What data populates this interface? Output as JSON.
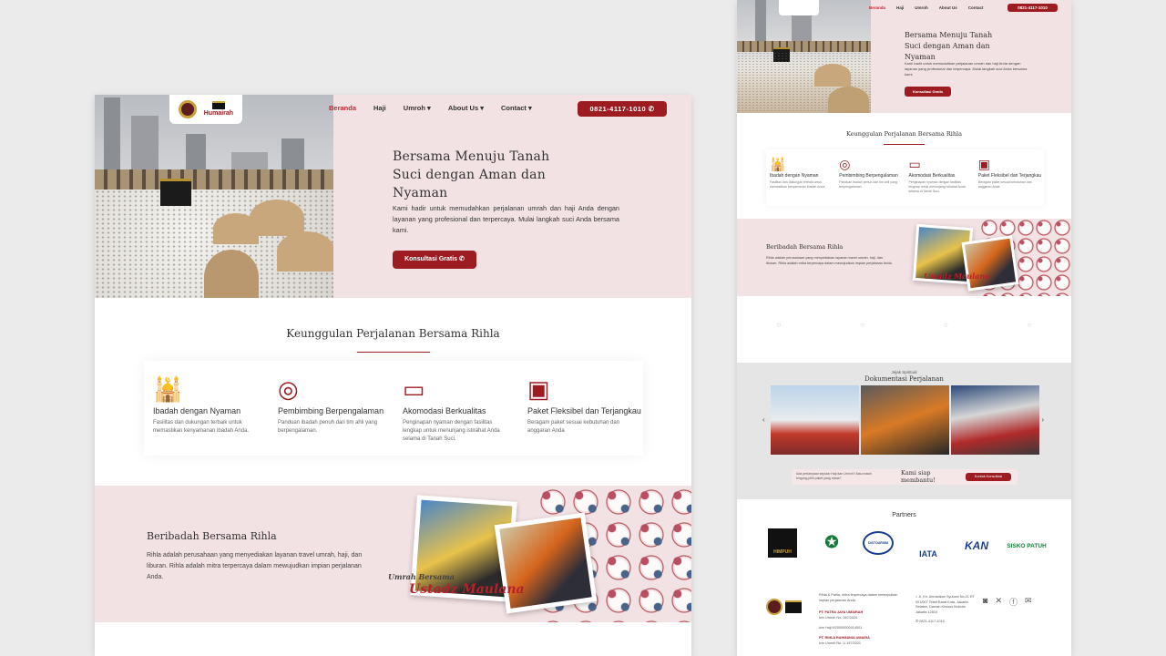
{
  "brand": {
    "name": "Humairah",
    "accent": "#9d1c22",
    "bg_pink": "#f3e2e4"
  },
  "nav": {
    "items": [
      {
        "label": "Beranda",
        "active": true,
        "dropdown": false
      },
      {
        "label": "Haji",
        "active": false,
        "dropdown": false
      },
      {
        "label": "Umroh",
        "active": false,
        "dropdown": true
      },
      {
        "label": "About Us",
        "active": false,
        "dropdown": true
      },
      {
        "label": "Contact",
        "active": false,
        "dropdown": true
      }
    ],
    "phone": "0821-4117-1010",
    "phone_icon": "whatsapp-icon"
  },
  "hero": {
    "title": "Bersama Menuju Tanah Suci dengan Aman dan Nyaman",
    "description": "Kami hadir untuk memudahkan perjalanan umrah dan haji Anda dengan layanan yang profesional dan terpercaya. Mulai langkah suci Anda bersama kami.",
    "cta": "Konsultasi Gratis"
  },
  "features": {
    "title": "Keunggulan Perjalanan Bersama Rihla",
    "items": [
      {
        "icon": "mosque-icon",
        "title": "Ibadah dengan Nyaman",
        "desc": "Fasilitas dan dukungan terbaik untuk memastikan kenyamanan ibadah Anda."
      },
      {
        "icon": "guide-icon",
        "title": "Pembimbing Berpengalaman",
        "desc": "Panduan ibadah penuh dari tim ahli yang berpengalaman."
      },
      {
        "icon": "bed-icon",
        "title": "Akomodasi Berkualitas",
        "desc": "Penginapan nyaman dengan fasilitas lengkap untuk menunjang istirahat Anda selama di Tanah Suci."
      },
      {
        "icon": "wallet-icon",
        "title": "Paket Fleksibel dan Terjangkau",
        "desc": "Beragam paket sesuai kebutuhan dan anggaran Anda"
      }
    ]
  },
  "about": {
    "title": "Beribadah Bersama Rihla",
    "desc": "Rihla adalah perusahaan yang menyediakan layanan travel umrah, haji, dan liburan. Rihla adalah mitra terpercaya dalam mewujudkan impian perjalanan Anda.",
    "script_small": "Umrah Bersama",
    "script_big": "Ustadz Maulana"
  },
  "gallery": {
    "kicker": "Jejak Spiritual",
    "title": "Dokumentasi Perjalanan"
  },
  "contact_bar": {
    "question": "Ada pertanyaan seputar Haji dan Umroh? Atau masih bingung pilih paket yang mana?",
    "headline": "Kami siap membantu!",
    "cta": "Kontak Konsultasi"
  },
  "partners": {
    "title": "Partners",
    "logos": [
      "HIMPUH",
      "Kemenag",
      "DISTOURISM",
      "IATA",
      "KAN",
      "SISKO PATUH"
    ]
  },
  "footer": {
    "tagline": "Rihla & Pahla, mitra terpercaya dalam mewujudkan impian perjalanan Anda.",
    "company1": "PT. PATRA JAYA UMAIRAH",
    "company1_l1": "Izin Umroh No. 067/2020",
    "company1_l2": "Izin Haji 9/20000000414001",
    "company2": "PT. RIHLA RAHMANIA UMAIRA",
    "company2_l1": "Izin Umroh No. U.197/2021",
    "address": "Jl. Kh. Ahmadkan Syubani No.21 RT 001/007 Tebet Barat Kota, Jakarta Selatan, Daerah Khusus Ibukota Jakarta 12810",
    "phone": "0821-4117-1010",
    "social": [
      "instagram-icon",
      "x-icon",
      "facebook-icon",
      "email-icon"
    ]
  }
}
